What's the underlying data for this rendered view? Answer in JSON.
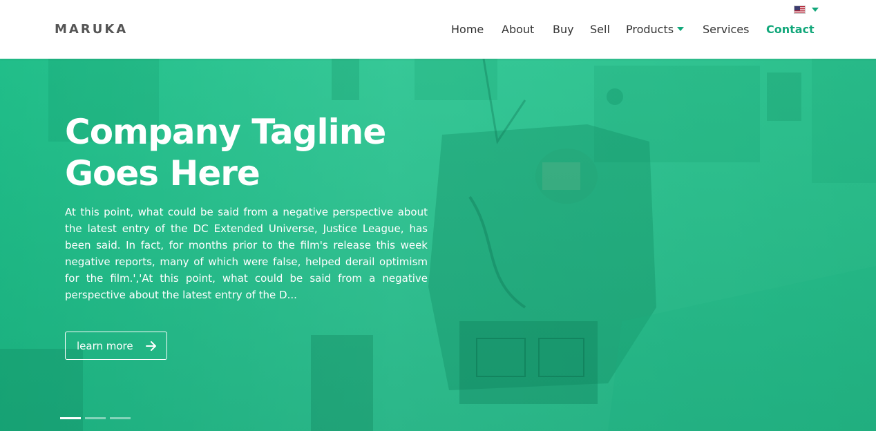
{
  "header": {
    "logo": "MARUKA",
    "nav": {
      "home": "Home",
      "about": "About",
      "buy": "Buy",
      "sell": "Sell",
      "products": "Products",
      "services": "Services",
      "contact": "Contact"
    },
    "language_icon": "us-flag-icon"
  },
  "hero": {
    "tagline": "Company Tagline Goes Here",
    "description": "At this point, what could be said from a negative perspective about the latest entry of the DC Extended Universe, Justice League, has been said. In fact, for months prior to the film's release this week negative reports, many of which were false, helped derail optimism for the film.','At this point, what could be said from a negative perspective about the latest entry of the D...",
    "button_label": "learn more",
    "slides": 3,
    "active_slide": 1
  },
  "colors": {
    "accent": "#11a77a",
    "hero_overlay": "#1ac48d"
  }
}
